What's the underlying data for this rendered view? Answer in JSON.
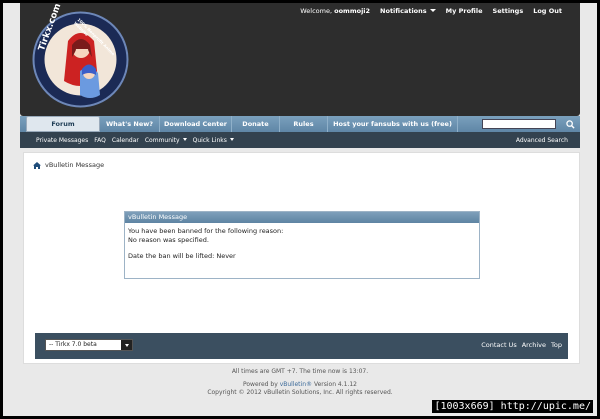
{
  "userbar": {
    "welcome": "Welcome,",
    "username": "oommoji2",
    "notifications": "Notifications",
    "my_profile": "My Profile",
    "settings": "Settings",
    "logout": "Log Out"
  },
  "logo": {
    "text": "Tirkx.com",
    "slogan": "100% Nonprofit Anime Website"
  },
  "navbar": {
    "tabs": [
      "Forum",
      "What's New?",
      "Download Center",
      "Donate",
      "Rules",
      "Host your fansubs with us (free)"
    ],
    "search_placeholder": ""
  },
  "subnav": {
    "items": [
      "Private Messages",
      "FAQ",
      "Calendar",
      "Community",
      "Quick Links"
    ],
    "advanced_search": "Advanced Search"
  },
  "breadcrumb": {
    "label": "vBulletin Message"
  },
  "message": {
    "title": "vBulletin Message",
    "line1": "You have been banned for the following reason:",
    "line2": "No reason was specified.",
    "line3": "Date the ban will be lifted: Never"
  },
  "footer": {
    "style_select": "-- Tirkx 7.0 beta",
    "links": [
      "Contact Us",
      "Archive",
      "Top"
    ]
  },
  "bottom": {
    "times": "All times are GMT +7. The time now is",
    "time_now": "13:07",
    "powered_prefix": "Powered by",
    "powered_link": "vBulletin®",
    "powered_suffix": "Version 4.1.12",
    "copyright": "Copyright © 2012 vBulletin Solutions, Inc. All rights reserved."
  },
  "watermark": "[1003x669] http://upic.me/",
  "colors": {
    "nav": "#6a8fae",
    "header": "#2d2d2d",
    "subnav": "#33424f",
    "footerbar": "#3b4f60"
  }
}
